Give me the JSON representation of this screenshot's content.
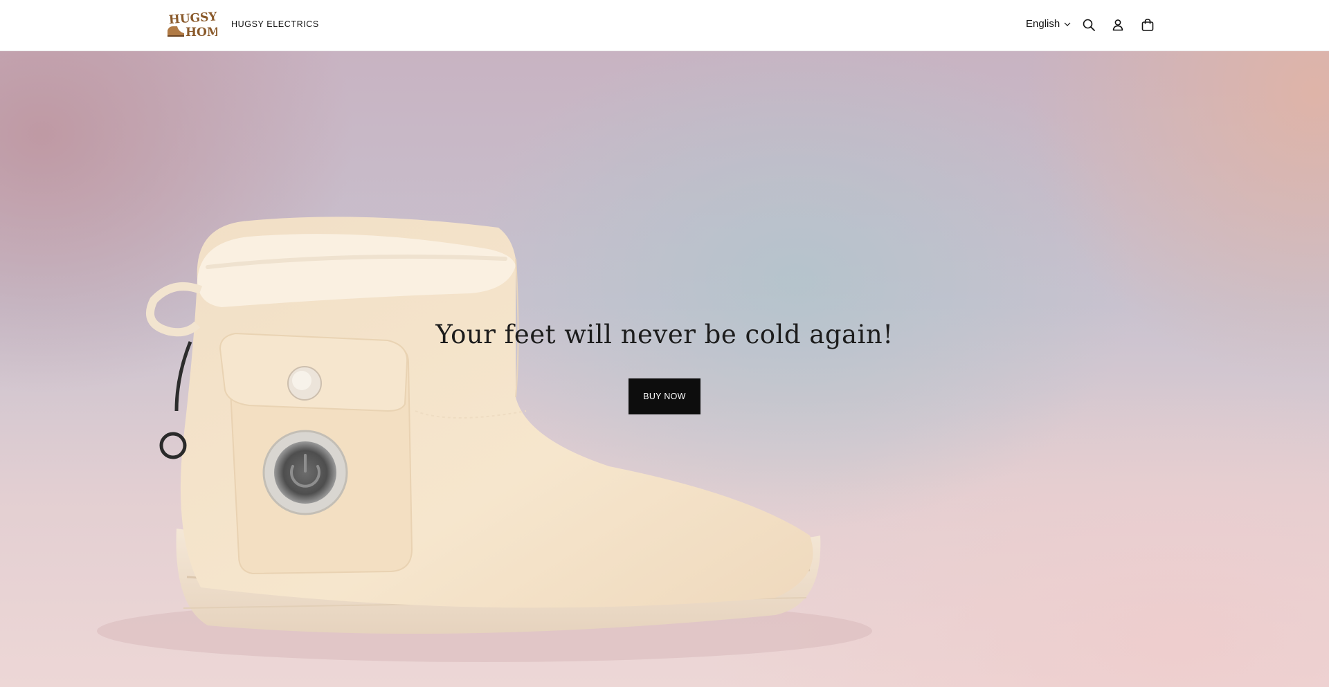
{
  "header": {
    "logo_text": "HUGSY HOME",
    "nav_link": "HUGSY ELECTRICS",
    "language": "English",
    "icons": [
      "search-icon",
      "account-icon",
      "cart-icon"
    ]
  },
  "hero": {
    "title": "Your feet will never be cold again!",
    "button_label": "BUY NOW",
    "image_subject": "heated-boot-image"
  },
  "colors": {
    "button_bg": "#0d0d0d",
    "button_text": "#ffffff",
    "logo_brown": "#8a5a2b",
    "boot_cream": "#f3e2c8"
  }
}
